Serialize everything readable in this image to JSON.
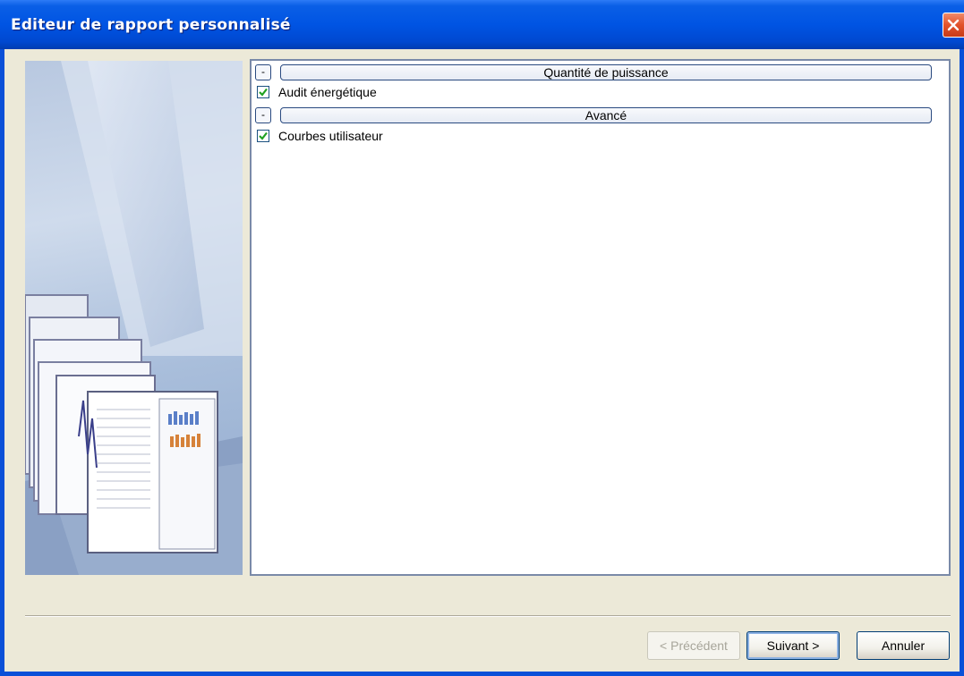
{
  "window": {
    "title": "Editeur de rapport personnalisé"
  },
  "groups": [
    {
      "toggle": "-",
      "title": "Quantité de puissance",
      "items": [
        {
          "label": "Audit énergétique",
          "checked": true
        }
      ]
    },
    {
      "toggle": "-",
      "title": "Avancé",
      "items": [
        {
          "label": "Courbes utilisateur",
          "checked": true
        }
      ]
    }
  ],
  "buttons": {
    "previous": {
      "label": "< Précédent",
      "enabled": false
    },
    "next": {
      "label": "Suivant >",
      "enabled": true
    },
    "cancel": {
      "label": "Annuler",
      "enabled": true
    }
  },
  "colors": {
    "titlebar": "#0054e3",
    "window_bg": "#ece9d8",
    "close": "#e2522b",
    "check": "#21a121"
  },
  "icons": {
    "close": "close-icon",
    "check": "checkmark-icon"
  }
}
